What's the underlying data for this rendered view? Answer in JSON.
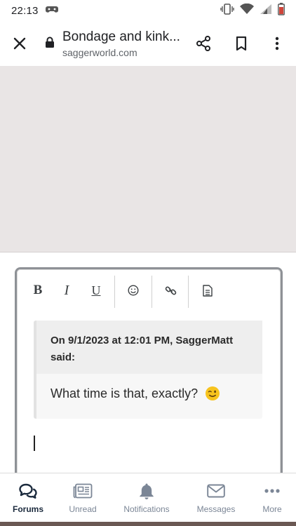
{
  "status_bar": {
    "time": "22:13"
  },
  "toolbar": {
    "page_title": "Bondage and kink...",
    "domain": "saggerworld.com"
  },
  "editor": {
    "toolbar": {
      "bold": "B",
      "italic": "I",
      "underline": "U"
    },
    "quote": {
      "header": "On 9/1/2023 at 12:01 PM, SaggerMatt said:",
      "body": "What time is that, exactly?"
    }
  },
  "bottom_nav": {
    "items": [
      {
        "label": "Forums",
        "icon": "forums-icon",
        "active": true
      },
      {
        "label": "Unread",
        "icon": "unread-icon",
        "active": false
      },
      {
        "label": "Notifications",
        "icon": "bell-icon",
        "active": false
      },
      {
        "label": "Messages",
        "icon": "envelope-icon",
        "active": false
      },
      {
        "label": "More",
        "icon": "more-dots-icon",
        "active": false
      }
    ]
  },
  "colors": {
    "accent_active": "#1b2a3d",
    "nav_inactive": "#7b8696",
    "blank_area": "#e9e5e5",
    "editor_border": "#8e9196"
  }
}
